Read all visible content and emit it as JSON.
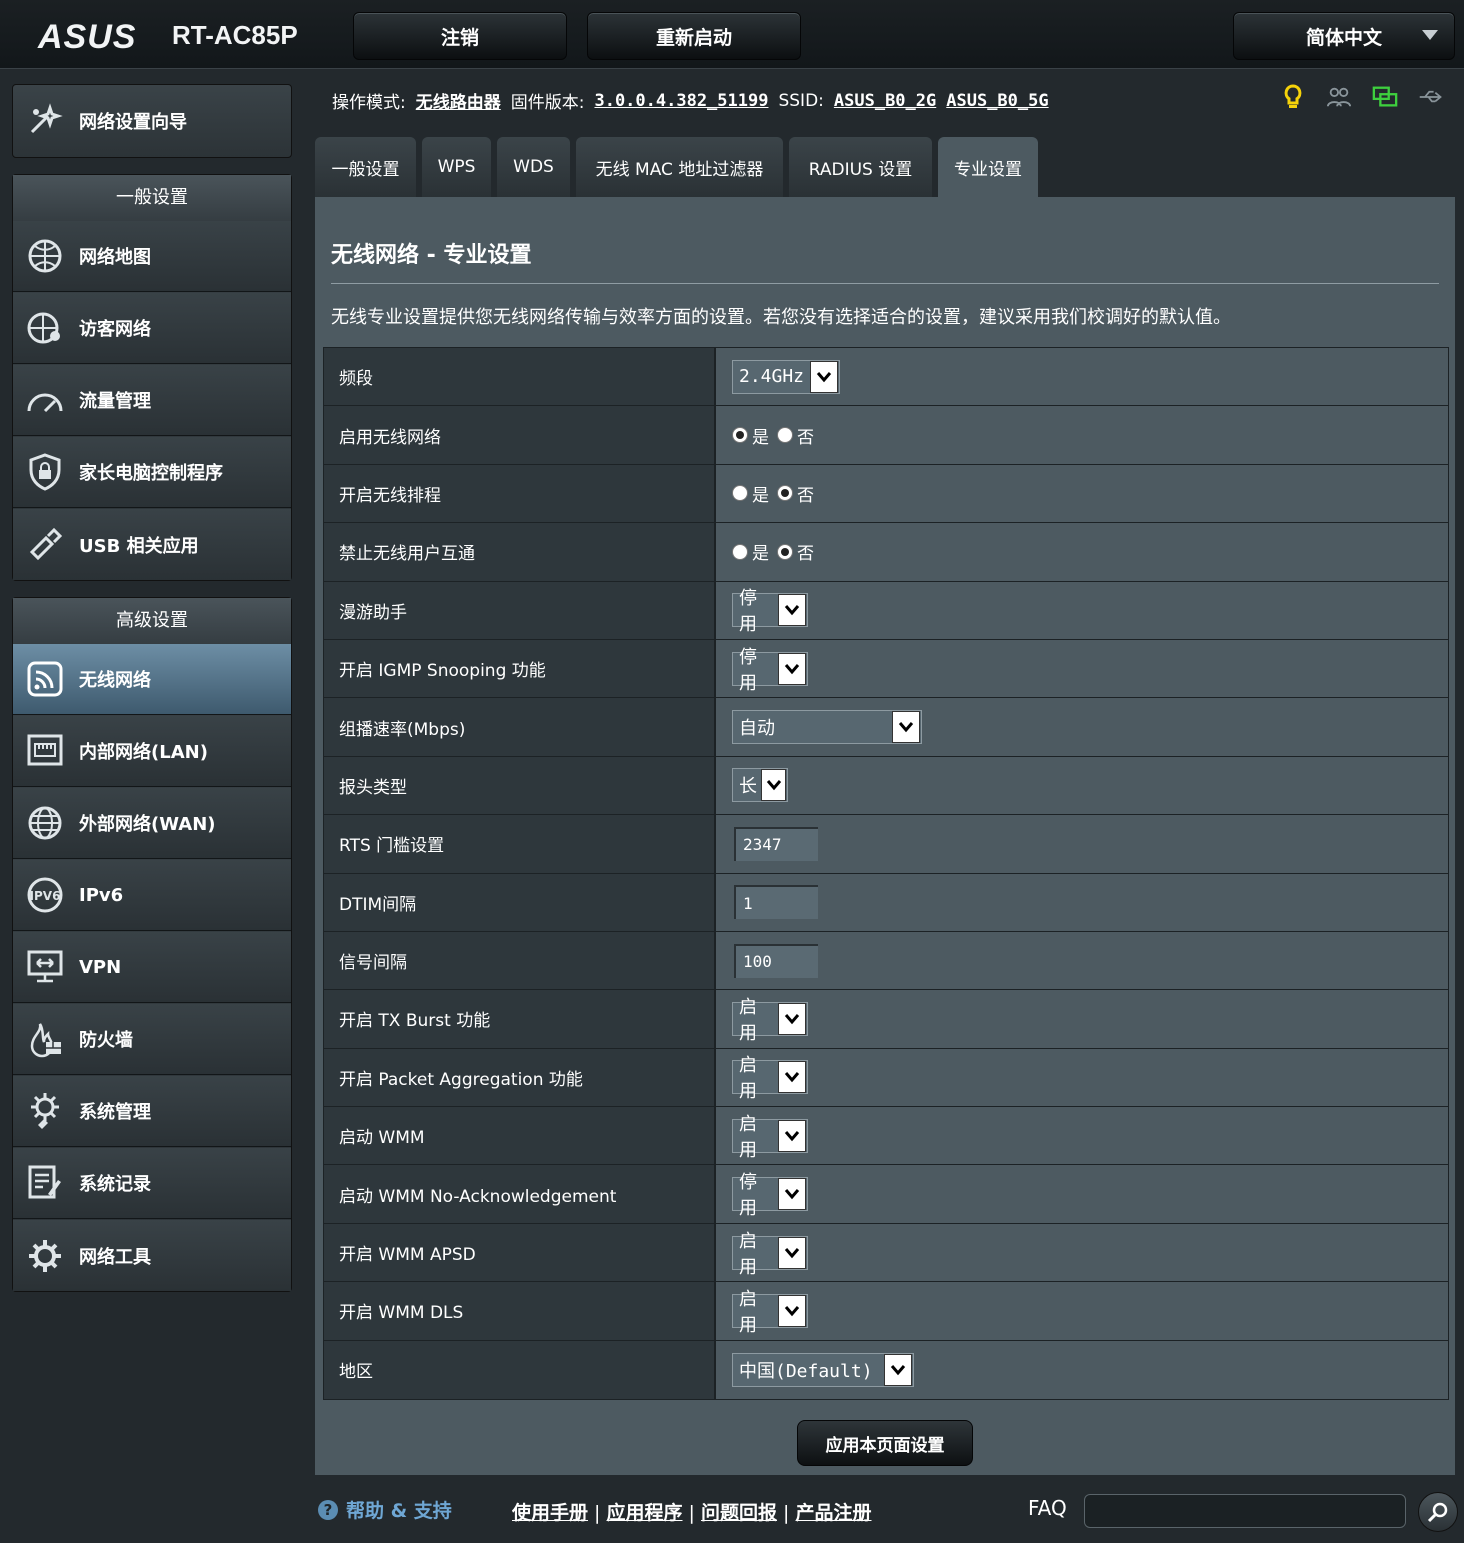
{
  "header": {
    "logo": "ASUS",
    "model": "RT-AC85P",
    "logout": "注销",
    "reboot": "重新启动",
    "language": "简体中文"
  },
  "status": {
    "mode_label": "操作模式:",
    "mode_value": "无线路由器",
    "firmware_label": "固件版本:",
    "firmware_value": "3.0.0.4.382_51199",
    "ssid_label": "SSID:",
    "ssid_2g": "ASUS_B0_2G",
    "ssid_5g": "ASUS_B0_5G"
  },
  "sidebar": {
    "wizard": "网络设置向导",
    "general_title": "一般设置",
    "general_items": [
      "网络地图",
      "访客网络",
      "流量管理",
      "家长电脑控制程序",
      "USB 相关应用"
    ],
    "advanced_title": "高级设置",
    "advanced_items": [
      "无线网络",
      "内部网络(LAN)",
      "外部网络(WAN)",
      "IPv6",
      "VPN",
      "防火墙",
      "系统管理",
      "系统记录",
      "网络工具"
    ]
  },
  "tabs": [
    "一般设置",
    "WPS",
    "WDS",
    "无线 MAC 地址过滤器",
    "RADIUS 设置",
    "专业设置"
  ],
  "main": {
    "title": "无线网络 - 专业设置",
    "description": "无线专业设置提供您无线网络传输与效率方面的设置。若您没有选择适合的设置，建议采用我们校调好的默认值。",
    "apply": "应用本页面设置"
  },
  "radio_labels": {
    "yes": "是",
    "no": "否"
  },
  "settings": [
    {
      "label": "频段",
      "type": "select",
      "value": "2.4GHz"
    },
    {
      "label": "启用无线网络",
      "type": "radio",
      "value": "是"
    },
    {
      "label": "开启无线排程",
      "type": "radio",
      "value": "否"
    },
    {
      "label": "禁止无线用户互通",
      "type": "radio",
      "value": "否"
    },
    {
      "label": "漫游助手",
      "type": "select",
      "value": "停用"
    },
    {
      "label": "开启 IGMP Snooping 功能",
      "type": "select",
      "value": "停用"
    },
    {
      "label": "组播速率(Mbps)",
      "type": "select",
      "value": "自动"
    },
    {
      "label": "报头类型",
      "type": "select",
      "value": "长"
    },
    {
      "label": "RTS 门槛设置",
      "type": "input",
      "value": "2347"
    },
    {
      "label": "DTIM间隔",
      "type": "input",
      "value": "1"
    },
    {
      "label": "信号间隔",
      "type": "input",
      "value": "100"
    },
    {
      "label": "开启 TX Burst 功能",
      "type": "select",
      "value": "启用"
    },
    {
      "label": "开启 Packet Aggregation 功能",
      "type": "select",
      "value": "启用"
    },
    {
      "label": "启动 WMM",
      "type": "select",
      "value": "启用"
    },
    {
      "label": "启动 WMM No-Acknowledgement",
      "type": "select",
      "value": "停用"
    },
    {
      "label": "开启 WMM APSD",
      "type": "select",
      "value": "启用"
    },
    {
      "label": "开启 WMM DLS",
      "type": "select",
      "value": "启用"
    },
    {
      "label": "地区",
      "type": "select",
      "value": "中国(Default)"
    }
  ],
  "footer": {
    "help": "帮助 & 支持",
    "links": [
      "使用手册",
      "应用程序",
      "问题回报",
      "产品注册"
    ],
    "faq": "FAQ"
  }
}
